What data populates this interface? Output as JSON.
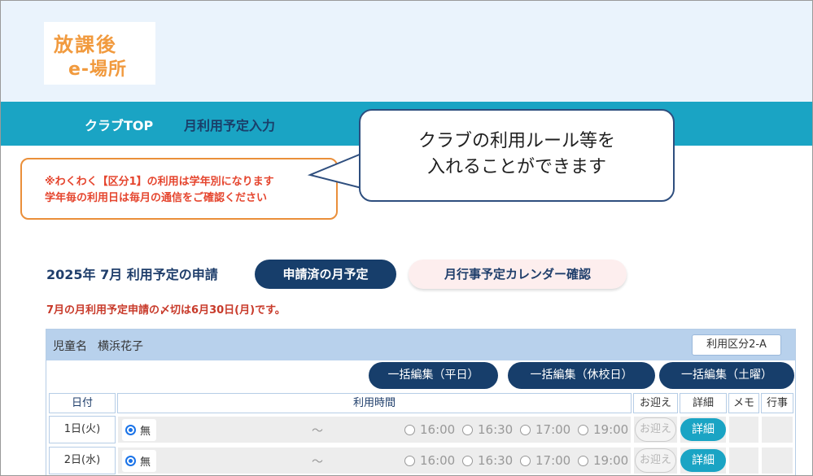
{
  "logo": {
    "line1": "放課後",
    "line2": "e-場所"
  },
  "nav": {
    "top": "クラブTOP",
    "plan_input": "月利用予定入力"
  },
  "notice": {
    "line1": "※わくわく【区分1】の利用は学年別になります",
    "line2": "学年毎の利用日は毎月の通信をご確認ください"
  },
  "callout": {
    "line1": "クラブの利用ルール等を",
    "line2": "入れることができます"
  },
  "month_title": "2025年 7月 利用予定の申請",
  "buttons": {
    "submitted": "申請済の月予定",
    "calendar": "月行事予定カレンダー確認"
  },
  "deadline": "7月の月利用予定申請の〆切は6月30日(月)です。",
  "panel": {
    "child_label": "児童名",
    "child_name": "横浜花子",
    "category": "利用区分2-A",
    "bulk": {
      "weekday": "一括編集（平日）",
      "holiday": "一括編集（休校日）",
      "saturday": "一括編集（土曜）"
    },
    "headers": {
      "date": "日付",
      "time": "利用時間",
      "pickup": "お迎え",
      "detail": "詳細",
      "memo": "メモ",
      "event": "行事"
    },
    "rows": [
      {
        "date": "1日(火)",
        "none": "無",
        "tilde": "〜",
        "slots": [
          "16:00",
          "16:30",
          "17:00",
          "19:00"
        ],
        "pickup": "お迎え",
        "detail": "詳細"
      },
      {
        "date": "2日(水)",
        "none": "無",
        "tilde": "〜",
        "slots": [
          "16:00",
          "16:30",
          "17:00",
          "19:00"
        ],
        "pickup": "お迎え",
        "detail": "詳細"
      }
    ]
  },
  "colors": {
    "nav": "#1aa4c4",
    "navy": "#173e6b",
    "header_bg": "#eaf3fc",
    "notice_border": "#ea8f3a",
    "notice_text": "#e5452e"
  }
}
